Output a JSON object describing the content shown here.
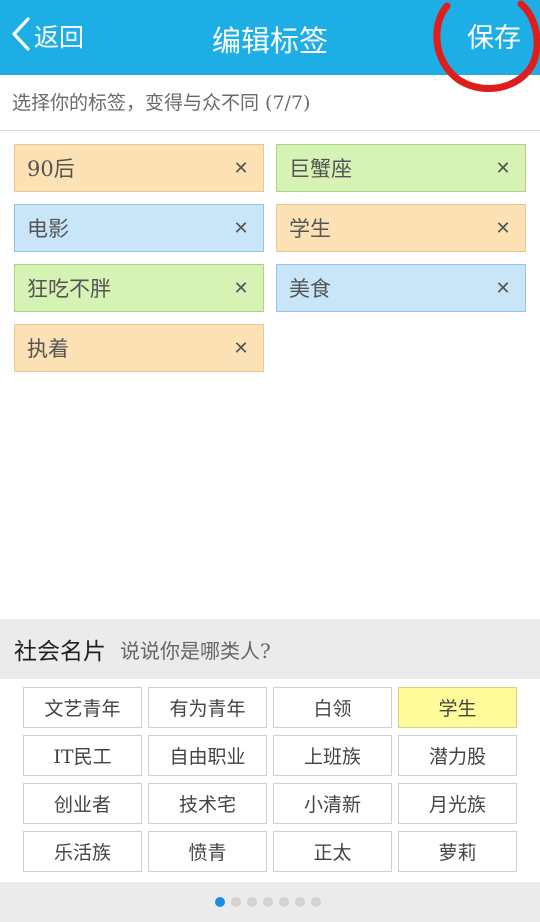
{
  "header": {
    "back_label": "返回",
    "title": "编辑标签",
    "save_label": "保存"
  },
  "subtitle": "选择你的标签，变得与众不同 (7/7)",
  "selected_tags": [
    {
      "label": "90后",
      "color": "orange"
    },
    {
      "label": "巨蟹座",
      "color": "green"
    },
    {
      "label": "电影",
      "color": "blue"
    },
    {
      "label": "学生",
      "color": "orange"
    },
    {
      "label": "狂吃不胖",
      "color": "green"
    },
    {
      "label": "美食",
      "color": "blue"
    },
    {
      "label": "执着",
      "color": "orange"
    }
  ],
  "remove_glyph": "✕",
  "social": {
    "title": "社会名片",
    "subtitle": "说说你是哪类人?",
    "chips": [
      [
        "文艺青年",
        "有为青年",
        "白领",
        "学生"
      ],
      [
        "IT民工",
        "自由职业",
        "上班族",
        "潜力股"
      ],
      [
        "创业者",
        "技术宅",
        "小清新",
        "月光族"
      ],
      [
        "乐活族",
        "愤青",
        "正太",
        "萝莉"
      ]
    ],
    "selected_chip": "学生"
  },
  "pager": {
    "total": 7,
    "active": 1
  },
  "colors": {
    "header_bg": "#1eaee6",
    "annotation_circle": "#e01d1d",
    "tag_orange": "#fbe1b3",
    "tag_green": "#d6f2b5",
    "tag_blue": "#c8e6f8",
    "chip_selected": "#fffb9a",
    "pager_active": "#1a8ee0"
  }
}
